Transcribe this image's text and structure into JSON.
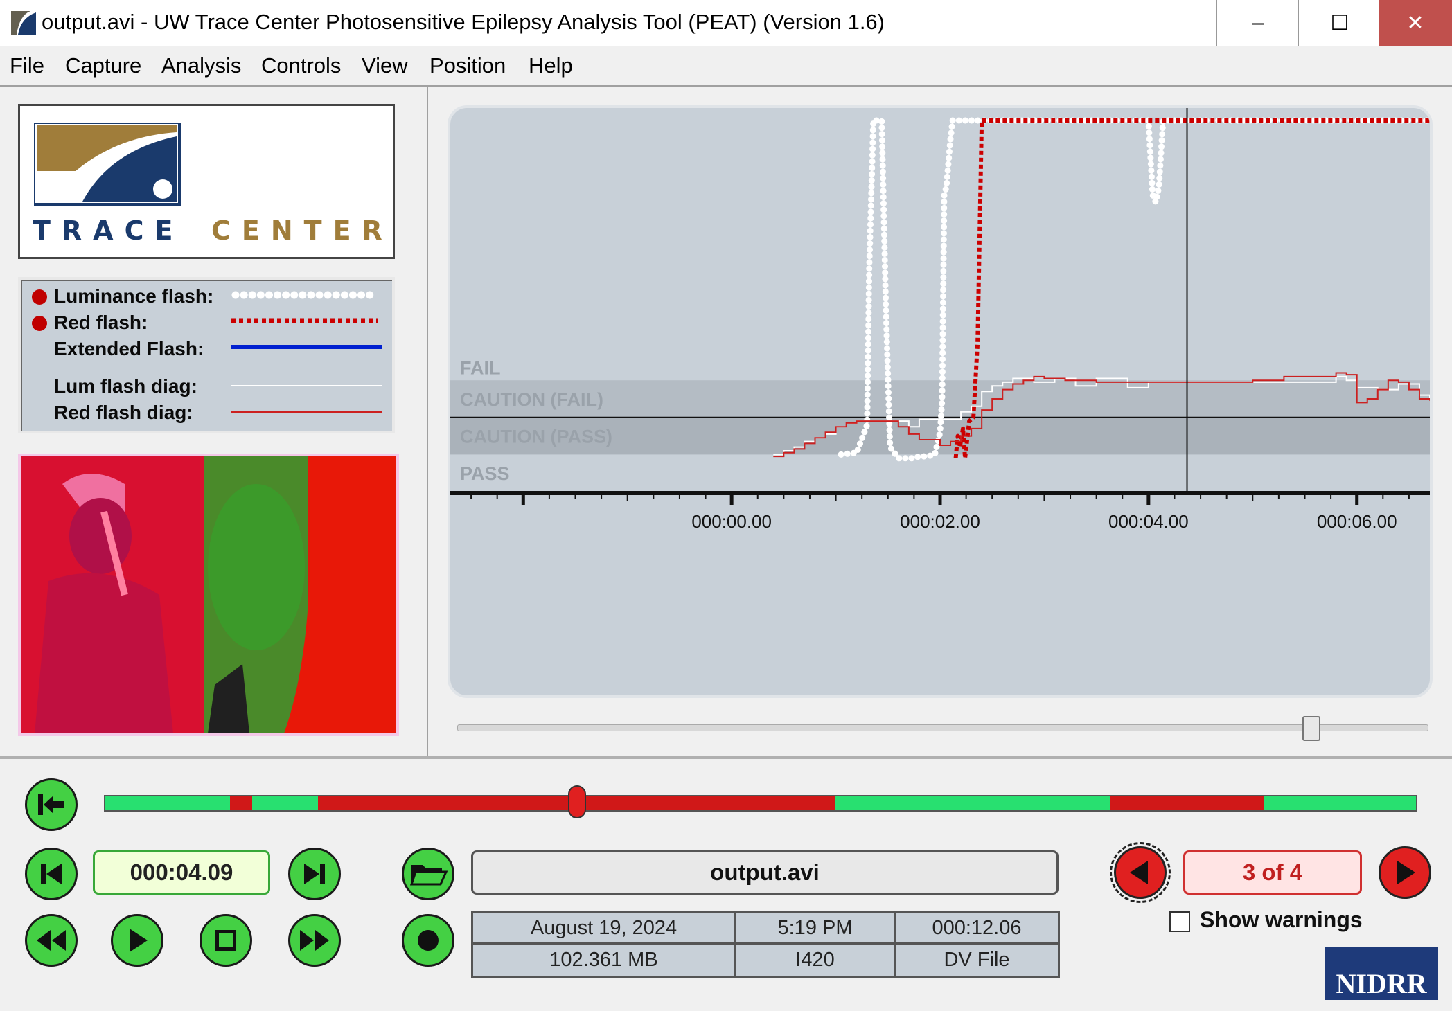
{
  "window": {
    "title": "output.avi - UW Trace Center Photosensitive Epilepsy Analysis Tool (PEAT) (Version 1.6)",
    "min_glyph": "–",
    "max_glyph": "☐",
    "close_glyph": "✕"
  },
  "menu": [
    "File",
    "Capture",
    "Analysis",
    "Controls",
    "View",
    "Position",
    "Help"
  ],
  "logo": {
    "word1": "TRACE",
    "word2": "CENTER"
  },
  "legend": {
    "items": [
      {
        "label": "Luminance flash:",
        "status_dot": true,
        "line_style": "dotted",
        "color": "#ffffff"
      },
      {
        "label": "Red flash:",
        "status_dot": true,
        "line_style": "dotted",
        "color": "#cc0000"
      },
      {
        "label": "Extended Flash:",
        "status_dot": false,
        "line_style": "solid",
        "color": "#0020d0"
      },
      {
        "label": "Lum flash diag:",
        "status_dot": false,
        "line_style": "thin",
        "color": "#ffffff"
      },
      {
        "label": "Red flash diag:",
        "status_dot": false,
        "line_style": "thin",
        "color": "#cc2020"
      }
    ]
  },
  "chart_data": {
    "type": "line",
    "zones": [
      "FAIL",
      "CAUTION (FAIL)",
      "CAUTION (PASS)",
      "PASS"
    ],
    "x_ticks": [
      "000:00.00",
      "000:02.00",
      "000:04.00",
      "000:06.00"
    ],
    "xlim": [
      -2.7,
      6.7
    ],
    "cursor_time": 4.37,
    "series": [
      {
        "name": "Luminance flash",
        "style": "dotted-thick",
        "color": "#ffffff",
        "points": [
          [
            1.05,
            1.0
          ],
          [
            1.2,
            1.05
          ],
          [
            1.3,
            1.8
          ],
          [
            1.32,
            6
          ],
          [
            1.36,
            10
          ],
          [
            1.38,
            10
          ],
          [
            1.44,
            10
          ],
          [
            1.48,
            5
          ],
          [
            1.52,
            1.2
          ],
          [
            1.6,
            0.9
          ],
          [
            1.75,
            0.9
          ],
          [
            1.8,
            0.95
          ],
          [
            1.88,
            0.95
          ],
          [
            1.95,
            1.0
          ],
          [
            2.0,
            1.6
          ],
          [
            2.02,
            2.5
          ],
          [
            2.04,
            8
          ],
          [
            2.06,
            8.2
          ],
          [
            2.1,
            9.5
          ],
          [
            2.12,
            10
          ],
          [
            2.4,
            10
          ],
          [
            4.0,
            10
          ],
          [
            4.04,
            8
          ],
          [
            4.07,
            7.8
          ],
          [
            4.1,
            8.2
          ],
          [
            4.14,
            10
          ],
          [
            6.7,
            10
          ]
        ]
      },
      {
        "name": "Red flash",
        "style": "dotted-thick",
        "color": "#cc0000",
        "points": [
          [
            2.15,
            0.9
          ],
          [
            2.17,
            1.5
          ],
          [
            2.19,
            1.2
          ],
          [
            2.22,
            1.7
          ],
          [
            2.24,
            0.9
          ],
          [
            2.28,
            1.9
          ],
          [
            2.3,
            1.95
          ],
          [
            2.32,
            2.0
          ],
          [
            2.36,
            4
          ],
          [
            2.4,
            10
          ],
          [
            6.7,
            10
          ]
        ]
      },
      {
        "name": "Lum flash diag",
        "style": "step-thin",
        "color": "#ffffff",
        "points": [
          [
            0.4,
            1.0
          ],
          [
            0.5,
            1.1
          ],
          [
            0.6,
            1.2
          ],
          [
            0.7,
            1.35
          ],
          [
            0.8,
            1.45
          ],
          [
            0.9,
            1.55
          ],
          [
            1.0,
            1.75
          ],
          [
            1.1,
            1.85
          ],
          [
            1.2,
            1.9
          ],
          [
            1.6,
            1.9
          ],
          [
            1.7,
            1.75
          ],
          [
            1.8,
            1.95
          ],
          [
            2.15,
            1.95
          ],
          [
            2.2,
            2.15
          ],
          [
            2.3,
            2.3
          ],
          [
            2.4,
            2.7
          ],
          [
            2.5,
            2.85
          ],
          [
            2.6,
            2.95
          ],
          [
            2.7,
            3.05
          ],
          [
            2.9,
            2.95
          ],
          [
            3.1,
            3.05
          ],
          [
            3.3,
            2.85
          ],
          [
            3.5,
            3.05
          ],
          [
            3.8,
            2.8
          ],
          [
            4.0,
            2.95
          ],
          [
            4.2,
            2.95
          ],
          [
            5.8,
            3.1
          ],
          [
            5.9,
            3.0
          ],
          [
            6.0,
            2.8
          ],
          [
            6.2,
            2.75
          ],
          [
            6.4,
            2.9
          ],
          [
            6.6,
            2.6
          ],
          [
            6.7,
            2.5
          ]
        ]
      },
      {
        "name": "Red flash diag",
        "style": "step-thin",
        "color": "#cc2020",
        "points": [
          [
            0.4,
            0.95
          ],
          [
            0.5,
            1.05
          ],
          [
            0.6,
            1.15
          ],
          [
            0.7,
            1.3
          ],
          [
            0.8,
            1.45
          ],
          [
            0.9,
            1.6
          ],
          [
            1.0,
            1.75
          ],
          [
            1.1,
            1.85
          ],
          [
            1.2,
            1.9
          ],
          [
            1.5,
            1.9
          ],
          [
            1.6,
            1.75
          ],
          [
            1.7,
            1.55
          ],
          [
            1.8,
            1.4
          ],
          [
            2.0,
            1.25
          ],
          [
            2.1,
            1.35
          ],
          [
            2.2,
            1.5
          ],
          [
            2.3,
            1.7
          ],
          [
            2.4,
            2.2
          ],
          [
            2.5,
            2.5
          ],
          [
            2.6,
            2.75
          ],
          [
            2.7,
            2.9
          ],
          [
            2.8,
            3.0
          ],
          [
            2.9,
            3.1
          ],
          [
            3.0,
            3.05
          ],
          [
            3.2,
            3.0
          ],
          [
            3.5,
            2.95
          ],
          [
            4.5,
            2.95
          ],
          [
            5.0,
            3.0
          ],
          [
            5.3,
            3.1
          ],
          [
            5.8,
            3.2
          ],
          [
            5.9,
            3.15
          ],
          [
            6.0,
            2.4
          ],
          [
            6.1,
            2.5
          ],
          [
            6.2,
            2.75
          ],
          [
            6.3,
            3.0
          ],
          [
            6.4,
            2.95
          ],
          [
            6.5,
            2.75
          ],
          [
            6.6,
            2.5
          ],
          [
            6.7,
            2.45
          ]
        ]
      }
    ]
  },
  "controls": {
    "current_time": "000:04.09",
    "filename": "output.avi",
    "info": {
      "date": "August 19, 2024",
      "time": "5:19 PM",
      "duration": "000:12.06",
      "size": "102.361 MB",
      "format": "I420",
      "type": "DV File"
    },
    "warning_counter": "3 of 4",
    "show_warnings_label": "Show warnings",
    "show_warnings_checked": false,
    "playhead_fraction": 0.36,
    "timeline_segments": [
      {
        "start": 0.0,
        "end": 0.095,
        "status": "pass"
      },
      {
        "start": 0.095,
        "end": 0.112,
        "status": "fail"
      },
      {
        "start": 0.112,
        "end": 0.162,
        "status": "pass"
      },
      {
        "start": 0.162,
        "end": 0.167,
        "status": "fail"
      },
      {
        "start": 0.167,
        "end": 0.557,
        "status": "fail"
      },
      {
        "start": 0.557,
        "end": 0.767,
        "status": "pass"
      },
      {
        "start": 0.767,
        "end": 0.884,
        "status": "fail"
      },
      {
        "start": 0.884,
        "end": 1.0,
        "status": "pass"
      }
    ],
    "colors": {
      "pass": "#28e070",
      "fail": "#d01818"
    }
  },
  "badge": "NIDRR"
}
